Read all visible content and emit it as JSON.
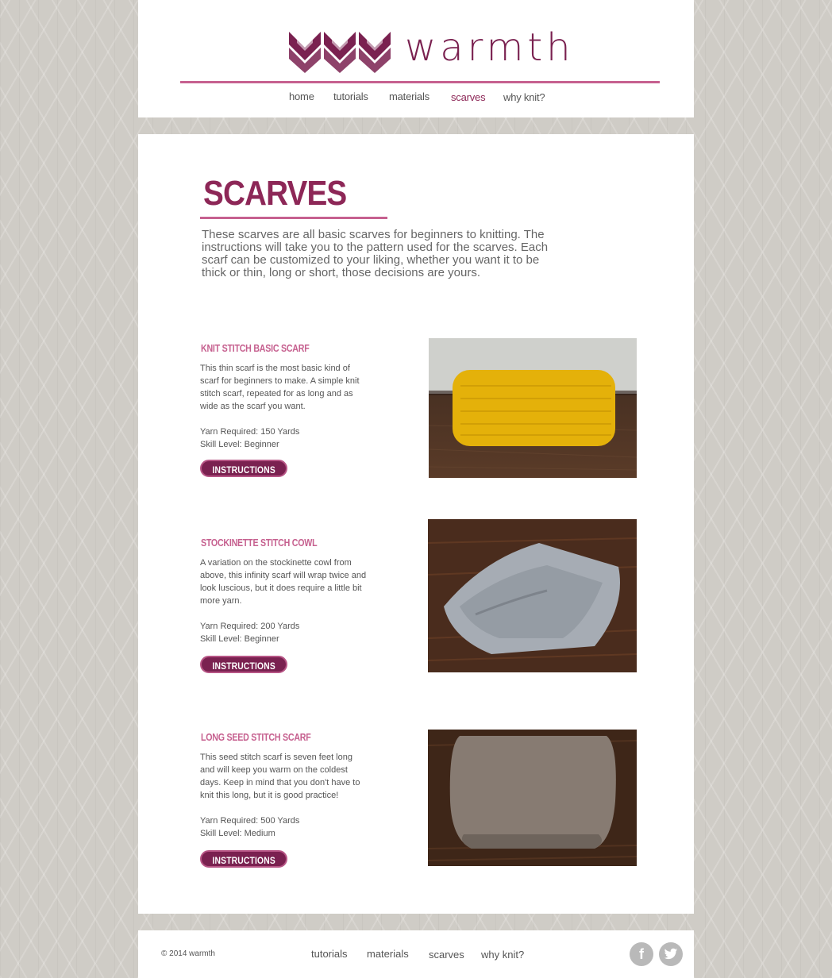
{
  "brand": {
    "name": "warmth",
    "accent": "#8d2757",
    "accent_light": "#c6608f"
  },
  "nav": {
    "items": [
      "home",
      "tutorials",
      "materials",
      "scarves",
      "why knit?"
    ],
    "active": "scarves"
  },
  "page": {
    "title": "SCARVES",
    "intro": "These scarves are all basic scarves for beginners to knitting. The instructions will take you to the pattern used for the scarves. Each scarf can be customized to your liking, whether you want it to be thick or thin, long or short, those decisions are yours."
  },
  "items": [
    {
      "title": "KNIT STITCH BASIC SCARF",
      "description": "This thin scarf is the most basic kind of scarf for beginners to make. A simple knit stitch scarf, repeated for as long and as wide as the scarf you want.",
      "yarn": "Yarn Required: 150 Yards",
      "skill": "Skill Level: Beginner",
      "button": "INSTRUCTIONS",
      "photo_color": "#e9b70d"
    },
    {
      "title": "STOCKINETTE STITCH COWL",
      "description": "A variation on the stockinette cowl from above, this infinity scarf will wrap twice and look luscious, but it does require a little bit more yarn.",
      "yarn": "Yarn Required: 200 Yards",
      "skill": "Skill Level: Beginner",
      "button": "INSTRUCTIONS",
      "photo_color": "#9ea4ad"
    },
    {
      "title": "LONG SEED STITCH SCARF",
      "description": "This seed stitch scarf is seven feet long and will keep you warm on the coldest days. Keep in mind that you don't have to knit this long, but it is good practice!",
      "yarn": "Yarn Required: 500 Yards",
      "skill": "Skill Level: Medium",
      "button": "INSTRUCTIONS",
      "photo_color": "#8c8078"
    }
  ],
  "footer": {
    "copyright": "© 2014 warmth",
    "nav": [
      "tutorials",
      "materials",
      "scarves",
      "why knit?"
    ],
    "social": [
      "facebook-icon",
      "twitter-icon"
    ]
  }
}
